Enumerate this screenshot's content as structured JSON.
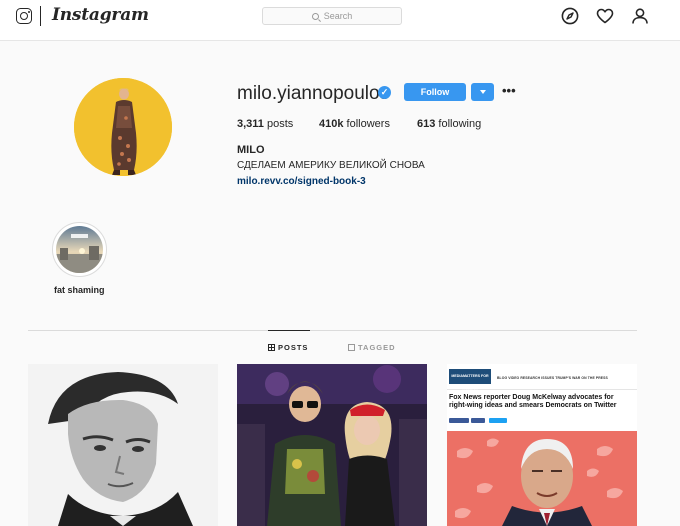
{
  "nav": {
    "wordmark": "Instagram",
    "search_placeholder": "Search"
  },
  "profile": {
    "username": "milo.yiannopoulos",
    "verified": true,
    "follow_label": "Follow",
    "posts_count": "3,311",
    "posts_label": "posts",
    "followers_count": "410k",
    "followers_label": "followers",
    "following_count": "613",
    "following_label": "following",
    "display_name": "MILO",
    "bio": "СДЕЛАЕМ АМЕРИКУ ВЕЛИКОЙ СНОВА",
    "link": "milo.revv.co/signed-book-3"
  },
  "highlights": [
    {
      "label": "fat shaming"
    }
  ],
  "tabs": [
    {
      "label": "POSTS",
      "active": true
    },
    {
      "label": "TAGGED",
      "active": false
    }
  ],
  "posts": [
    {
      "kind": "portrait-bw"
    },
    {
      "kind": "party-photo"
    },
    {
      "kind": "article-screenshot",
      "site": "MEDIAMATTERS",
      "site_sub": "FOR AMERICA",
      "nav_items": "BLOG   VIDEO   RESEARCH   ISSUES   TRUMP'S WAR ON THE PRESS",
      "headline": "Fox News reporter Doug McKelway advocates for right-wing ideas and smears Democrats on Twitter"
    }
  ],
  "colors": {
    "accent": "#3897f0",
    "link": "#003569",
    "avatar_bg": "#f2c12e",
    "mm_brand": "#1e4d79",
    "mm_image_bg": "#ec7065"
  }
}
